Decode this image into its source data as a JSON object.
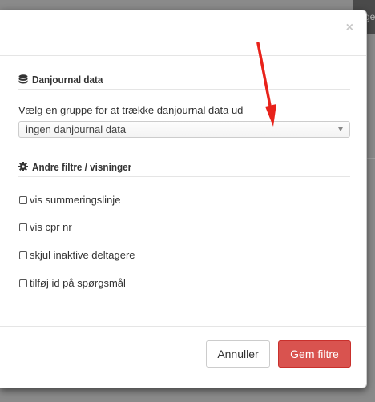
{
  "background": {
    "partial_text": "ge"
  },
  "modal": {
    "close_glyph": "×",
    "danjournal_section": {
      "icon": "database-icon",
      "title": "Danjournal data",
      "select_label": "Vælg en gruppe for at trække danjournal data ud",
      "select_value": "ingen danjournal data"
    },
    "filters_section": {
      "icon": "gear-icon",
      "title": "Andre filtre / visninger",
      "options": [
        {
          "label": "vis summeringslinje",
          "checked": false
        },
        {
          "label": "vis cpr nr",
          "checked": false
        },
        {
          "label": "skjul inaktive deltagere",
          "checked": false
        },
        {
          "label": "tilføj id på spørgsmål",
          "checked": false
        }
      ]
    },
    "footer": {
      "cancel_label": "Annuller",
      "save_label": "Gem filtre"
    }
  },
  "annotation": {
    "arrow_color": "#e8221a"
  },
  "colors": {
    "primary_danger": "#d9534f",
    "border": "#e5e5e5"
  }
}
